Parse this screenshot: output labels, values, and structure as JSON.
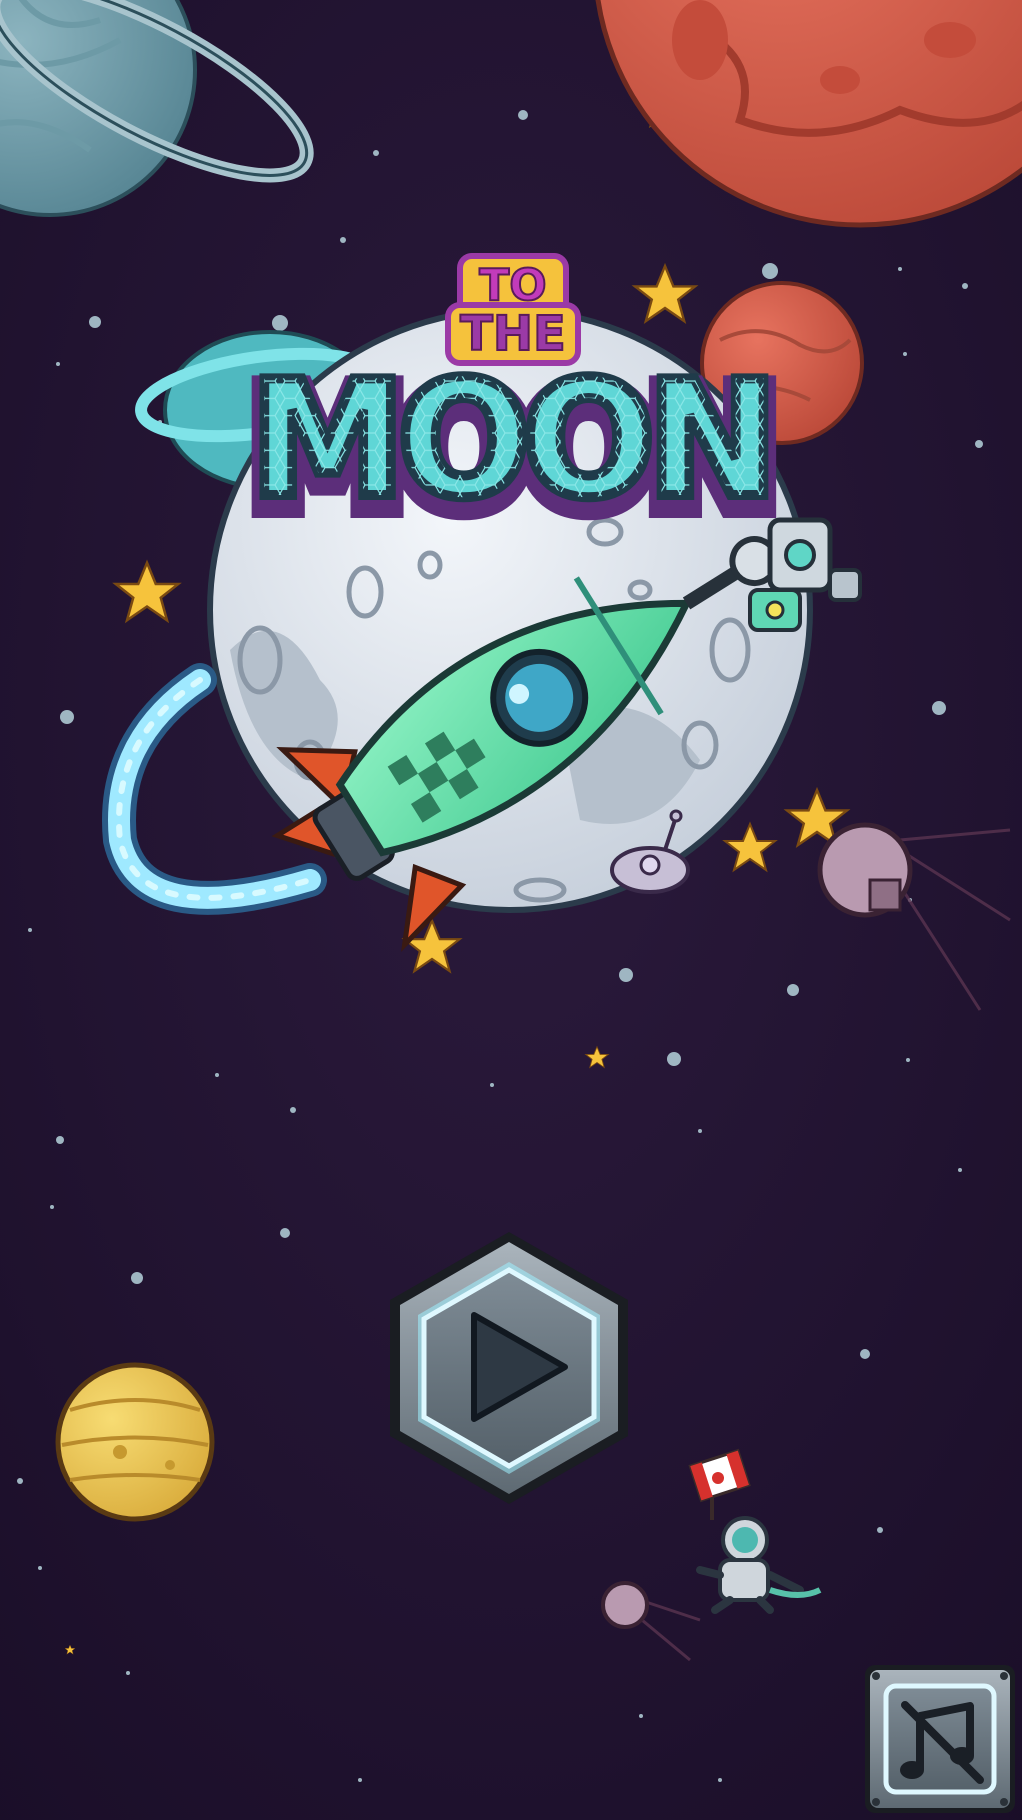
{
  "game": {
    "title_top": "TO",
    "title_mid": "THE",
    "title_main": "MOON"
  },
  "controls": {
    "play_button": {
      "icon": "play-icon",
      "state": "idle"
    },
    "music_toggle": {
      "icon": "music-muted-icon",
      "state": "muted"
    }
  },
  "scene": {
    "flag": "canada-flag-icon"
  },
  "colors": {
    "space_background": "#241433",
    "title_fill": "#5fd6d6",
    "title_outline": "#1f3b4a",
    "title_badge": "#f5c23c",
    "title_badge_outline": "#9b3aa6",
    "rocket_body": "#5fe0a6",
    "rocket_fin": "#e0552a",
    "moon_surface": "#dfe6ee",
    "star": "#f6c33c",
    "mars": "#d65c4b",
    "button_frame": "#8b96a0",
    "button_inner": "#6a7883",
    "button_glow": "#9ff1ff"
  }
}
